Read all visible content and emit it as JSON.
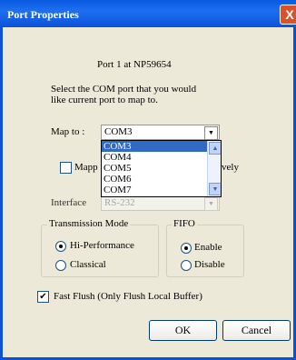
{
  "window": {
    "title": "Port Properties",
    "close_label": "X"
  },
  "header": {
    "port_line": "Port 1 at NP59654",
    "instruction_line1": "Select the COM port that you would",
    "instruction_line2": "like current port to map to."
  },
  "map_to": {
    "label": "Map to :",
    "value": "COM3",
    "options": [
      "COM3",
      "COM4",
      "COM5",
      "COM6",
      "COM7"
    ],
    "selected_index": 0
  },
  "mapping_checkbox": {
    "label_visible_left": "Mapp",
    "label_visible_right": "vely",
    "checked": false
  },
  "interface": {
    "label": "Interface",
    "value": "RS-232"
  },
  "transmission_mode": {
    "label": "Transmission Mode",
    "options": [
      "Hi-Performance",
      "Classical"
    ],
    "selected": "Hi-Performance"
  },
  "fifo": {
    "label": "FIFO",
    "options": [
      "Enable",
      "Disable"
    ],
    "selected": "Enable"
  },
  "fast_flush": {
    "label": "Fast Flush (Only Flush Local Buffer)",
    "checked": true
  },
  "buttons": {
    "ok": "OK",
    "cancel": "Cancel"
  }
}
